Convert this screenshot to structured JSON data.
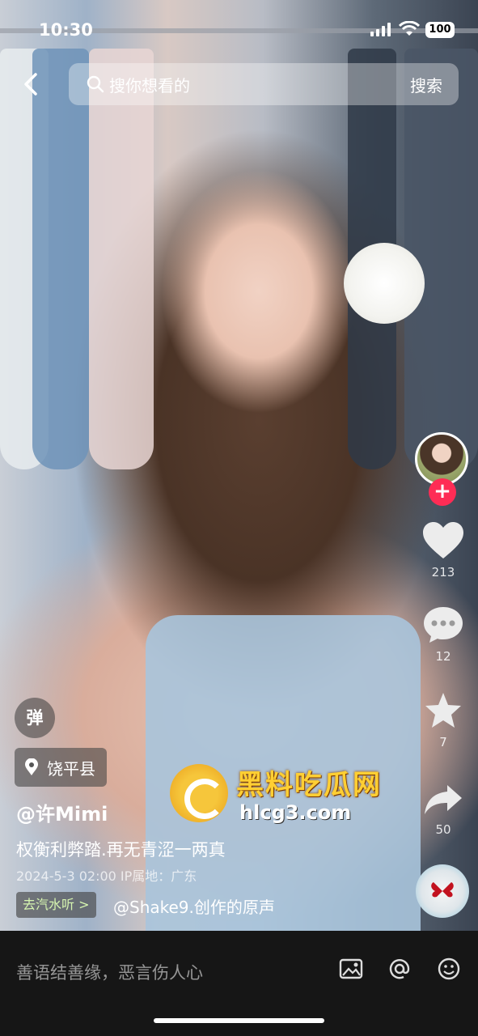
{
  "status_bar": {
    "time": "10:30",
    "battery": "100"
  },
  "search": {
    "placeholder": "搜你想看的",
    "button_label": "搜索"
  },
  "rail": {
    "like_count": "213",
    "comment_count": "12",
    "favorite_count": "7",
    "share_count": "50"
  },
  "overlay": {
    "danmu_label": "弹",
    "location": "饶平县",
    "author": "@许Mimi",
    "description": "权衡利弊踏.再无青涩一两真",
    "meta": "2024-5-3 02:00 IP属地：广东",
    "qishui_label": "去汽水听 >",
    "music": "@Shake9.创作的原声"
  },
  "watermark": {
    "title": "黑料吃瓜网",
    "url": "hlcg3.com"
  },
  "bottom_bar": {
    "comment_placeholder": "善语结善缘，恶言伤人心"
  },
  "colors": {
    "accent": "#fe2c55",
    "watermark": "#ffcf33"
  }
}
